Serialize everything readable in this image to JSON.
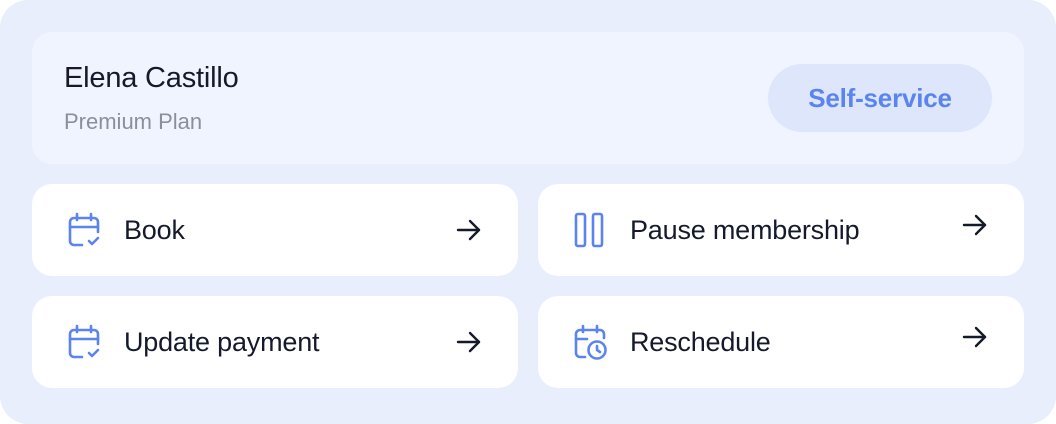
{
  "profile": {
    "name": "Elena Castillo",
    "plan": "Premium Plan",
    "badge": "Self-service"
  },
  "actions": [
    {
      "label": "Book",
      "icon": "calendar-check-icon"
    },
    {
      "label": "Pause membership",
      "icon": "pause-icon"
    },
    {
      "label": "Update payment",
      "icon": "calendar-check-icon"
    },
    {
      "label": "Reschedule",
      "icon": "calendar-clock-icon"
    }
  ],
  "colors": {
    "background": "#e8eefc",
    "header_card": "#f0f4fe",
    "accent": "#5b84ef",
    "badge_bg": "#dde6fb",
    "text": "#141a2b",
    "muted_text": "#8a8f9c"
  }
}
